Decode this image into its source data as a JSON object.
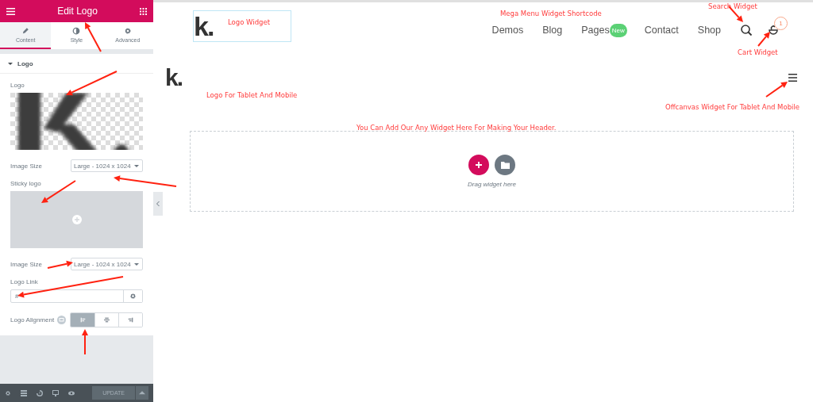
{
  "panel": {
    "title": "Edit Logo",
    "tabs": [
      {
        "label": "Content",
        "selected": true
      },
      {
        "label": "Style",
        "selected": false
      },
      {
        "label": "Advanced",
        "selected": false
      }
    ],
    "section": {
      "title": "Logo",
      "expanded": true
    },
    "logo_label": "Logo",
    "image_size_1": {
      "label": "Image Size",
      "value": "Large - 1024 x 1024"
    },
    "sticky_label": "Sticky logo",
    "image_size_2": {
      "label": "Image Size",
      "value": "Large - 1024 x 1024"
    },
    "link": {
      "label": "Logo Link",
      "value": "#"
    },
    "alignment": {
      "label": "Logo Alignment",
      "options": [
        {
          "selected": true
        },
        {
          "selected": false
        },
        {
          "selected": false
        }
      ]
    },
    "footer": {
      "update": "UPDATE"
    }
  },
  "site": {
    "logo": "k.",
    "mobile_logo": "k.",
    "menu": [
      {
        "label": "Demos"
      },
      {
        "label": "Blog"
      },
      {
        "label": "Pages",
        "badge": "New"
      },
      {
        "label": "Contact"
      },
      {
        "label": "Shop"
      }
    ],
    "cart_count": "1",
    "dropzone": {
      "hint": "Drag widget here"
    }
  },
  "annotations": [
    "Logo Widget",
    "Mega Menu Widget Shortcode",
    "Search Widget",
    "Cart Widget",
    "Logo For Tablet And Mobile",
    "Offcanvas Widget For Tablet And Mobile",
    "You Can Add Our Any Widget Here For Making Your Header."
  ]
}
